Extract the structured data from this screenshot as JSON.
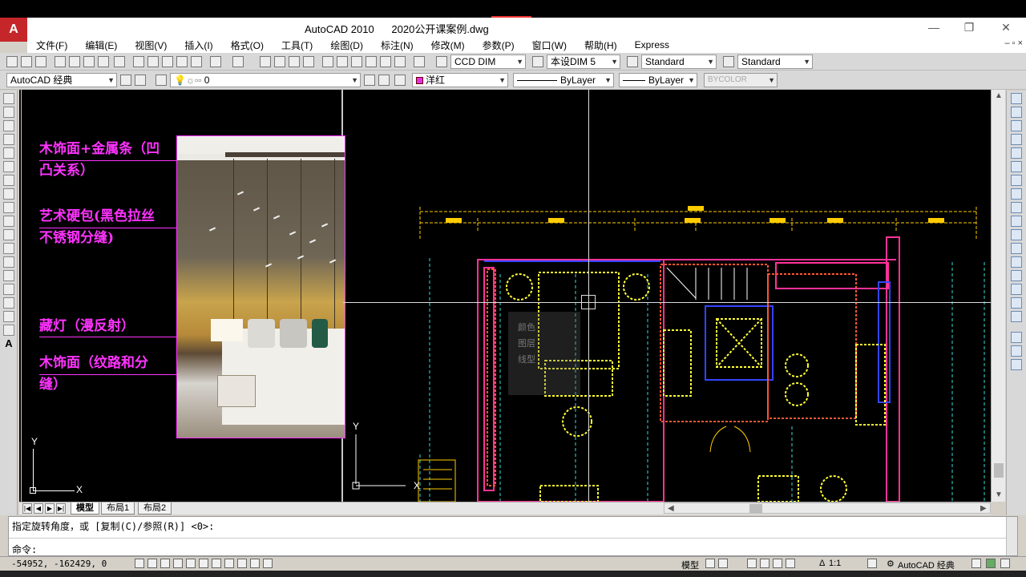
{
  "window": {
    "title": "AutoCAD 2010      2020公开课案例.dwg",
    "logo": "A",
    "minimize": "—",
    "restore": "❐",
    "close": "✕"
  },
  "menu": [
    "文件(F)",
    "编辑(E)",
    "视图(V)",
    "插入(I)",
    "格式(O)",
    "工具(T)",
    "绘图(D)",
    "标注(N)",
    "修改(M)",
    "参数(P)",
    "窗口(W)",
    "帮助(H)",
    "Express"
  ],
  "mdi_buttons": "– ▫ ×",
  "toolbar_standard": {
    "text_style": "CCD DIM",
    "dim_style": "本设DIM 5",
    "table_style": "Standard",
    "multileader_style": "Standard"
  },
  "toolbar_layers": {
    "workspace": "AutoCAD 经典",
    "layer": "0",
    "color": "洋红",
    "linetype": "ByLayer",
    "lineweight": "ByLayer",
    "plotstyle": "BYCOLOR"
  },
  "left_viewport": {
    "annotations": [
      "木饰面+金属条（凹\n凸关系）",
      "艺术硬包(黑色拉丝\n不锈钢分缝)",
      "藏灯（漫反射）",
      "木饰面（纹路和分\n缝）"
    ],
    "ucs_y": "Y",
    "ucs_x": "X"
  },
  "right_viewport": {
    "ucs_y": "Y",
    "ucs_x": "X",
    "tooltip_lines": [
      "颜色",
      "图层",
      "线型"
    ]
  },
  "layout_tabs": [
    "模型",
    "布局1",
    "布局2"
  ],
  "command": {
    "history": "指定旋转角度，或 [复制(C)/参照(R)] <0>:",
    "prompt": "命令:"
  },
  "status": {
    "coordinates": "-54952, -162429, 0",
    "model_label": "模型",
    "annotation_scale": "1:1",
    "workspace": "AutoCAD 经典"
  },
  "colors": {
    "annotation": "#ff33ff",
    "background": "#000000",
    "wall": "#ff3399",
    "furniture": "#ffff33",
    "dimension": "#ffcc00",
    "cyan_line": "#33dddd"
  }
}
